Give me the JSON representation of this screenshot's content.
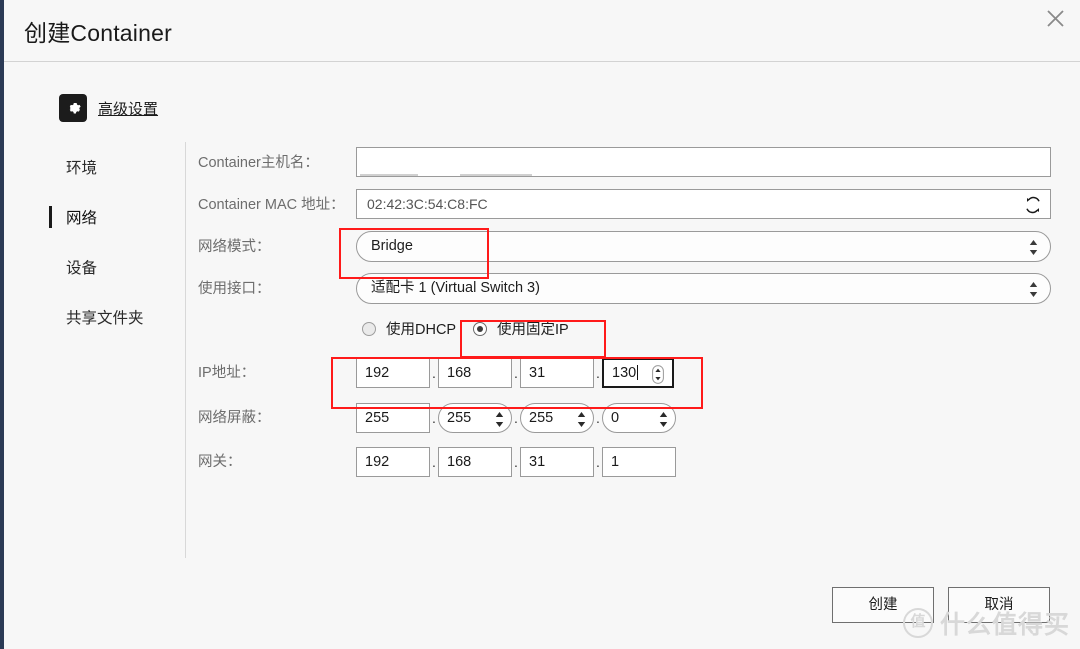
{
  "window": {
    "title": "创建Container",
    "close_icon": "close-icon",
    "accent_border": "#2b3a55"
  },
  "advanced": {
    "icon": "gear-icon",
    "label": "高级设置"
  },
  "sidebar": {
    "items": [
      {
        "label": "环境",
        "active": false
      },
      {
        "label": "网络",
        "active": true
      },
      {
        "label": "设备",
        "active": false
      },
      {
        "label": "共享文件夹",
        "active": false
      }
    ]
  },
  "form": {
    "hostname": {
      "label": "Container主机名：",
      "value": "",
      "redacted": true
    },
    "mac": {
      "label": "Container MAC 地址：",
      "value": "02:42:3C:54:C8:FC",
      "refresh_icon": "refresh-icon"
    },
    "network_mode": {
      "label": "网络模式：",
      "value": "Bridge",
      "chevron_icon": "spinner-updown-icon"
    },
    "interface": {
      "label": "使用接口：",
      "value": "适配卡 1 (Virtual Switch 3)",
      "chevron_icon": "spinner-updown-icon"
    },
    "ip_mode": {
      "dhcp_label": "使用DHCP",
      "static_label": "使用固定IP",
      "selected": "static"
    },
    "ip_address": {
      "label": "IP地址：",
      "octets": [
        "192",
        "168",
        "31",
        "130"
      ],
      "focused_index": 3,
      "separator": "."
    },
    "netmask": {
      "label": "网络屏蔽：",
      "octets": [
        "255",
        "255",
        "255",
        "0"
      ],
      "separator": "."
    },
    "gateway": {
      "label": "网关：",
      "octets": [
        "192",
        "168",
        "31",
        "1"
      ],
      "separator": "."
    }
  },
  "footer": {
    "create_label": "创建",
    "cancel_label": "取消"
  },
  "annotations": {
    "highlight_color": "#ff1a1a",
    "boxes": [
      "network-mode",
      "static-ip-radio",
      "ip-address-octets"
    ]
  },
  "watermark": {
    "badge": "值",
    "text": "什么值得买"
  }
}
